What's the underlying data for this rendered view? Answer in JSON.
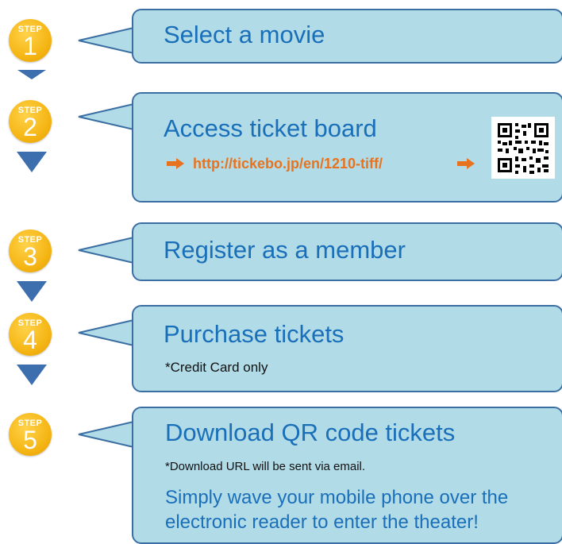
{
  "steps": [
    {
      "badge": "STEP",
      "number": "1",
      "title": "Select a movie"
    },
    {
      "badge": "STEP",
      "number": "2",
      "title": "Access ticket board",
      "url": "http://tickebo.jp/en/1210-tiff/"
    },
    {
      "badge": "STEP",
      "number": "3",
      "title": "Register as a member"
    },
    {
      "badge": "STEP",
      "number": "4",
      "title": "Purchase tickets",
      "note": "*Credit Card only"
    },
    {
      "badge": "STEP",
      "number": "5",
      "title": "Download QR code tickets",
      "note": "*Download URL will be sent via email.",
      "body": "Simply wave your mobile phone over the electronic reader to enter the theater!"
    }
  ],
  "colors": {
    "badge": "#f5b615",
    "box_fill": "#b2dbe8",
    "box_border": "#3b6fa3",
    "title": "#1a6fb9",
    "url": "#e8731e",
    "down_arrow": "#3d6fae"
  },
  "icons": {
    "step_arrow": "arrow-down-icon",
    "link_arrow": "arrow-right-icon",
    "qr": "qr-code-icon"
  }
}
